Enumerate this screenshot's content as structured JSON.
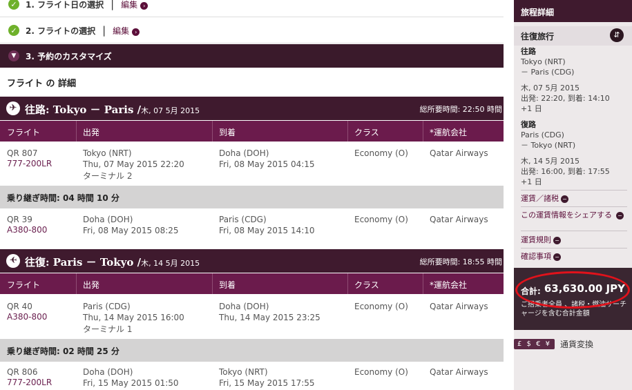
{
  "steps": [
    {
      "label": "1. フライト日の選択",
      "edit": "編集"
    },
    {
      "label": "2. フライトの選択",
      "edit": "編集"
    },
    {
      "label": "3. 予約のカスタマイズ"
    }
  ],
  "section_title": "フライト の 詳細",
  "columns": [
    "フライト",
    "出発",
    "到着",
    "クラス",
    "*運航会社"
  ],
  "outbound": {
    "route": "往路: Tokyo － Paris /",
    "date": "木, 07 5月 2015",
    "duration": "総所要時間: 22:50 時間",
    "seg1": {
      "flight": "QR 807",
      "aircraft": "777-200LR",
      "dep_city": "Tokyo (NRT)",
      "dep_time": "Thu, 07 May 2015 22:20",
      "terminal": "ターミナル 2",
      "arr_city": "Doha (DOH)",
      "arr_time": "Fri, 08 May 2015 04:15",
      "class": "Economy (O)",
      "carrier": "Qatar Airways"
    },
    "connection": "乗り継ぎ時間: 04 時間 10 分",
    "seg2": {
      "flight": "QR 39",
      "aircraft": "A380-800",
      "dep_city": "Doha (DOH)",
      "dep_time": "Fri, 08 May 2015 08:25",
      "arr_city": "Paris (CDG)",
      "arr_time": "Fri, 08 May 2015 14:10",
      "class": "Economy (O)",
      "carrier": "Qatar Airways"
    }
  },
  "inbound": {
    "route": "往復: Paris － Tokyo /",
    "date": "木, 14 5月 2015",
    "duration": "総所要時間: 18:55 時間",
    "seg1": {
      "flight": "QR 40",
      "aircraft": "A380-800",
      "dep_city": "Paris (CDG)",
      "dep_time": "Thu, 14 May 2015 16:00",
      "terminal": "ターミナル 1",
      "arr_city": "Doha (DOH)",
      "arr_time": "Thu, 14 May 2015 23:25",
      "class": "Economy (O)",
      "carrier": "Qatar Airways"
    },
    "connection": "乗り継ぎ時間: 02 時間 25 分",
    "seg2": {
      "flight": "QR 806",
      "aircraft": "777-200LR",
      "dep_city": "Doha (DOH)",
      "dep_time": "Fri, 15 May 2015 01:50",
      "arr_city": "Tokyo (NRT)",
      "arr_time": "Fri, 15 May 2015 17:55",
      "class": "Economy (O)",
      "carrier": "Qatar Airways"
    }
  },
  "sidebar": {
    "title": "旅程詳細",
    "trip_type": "往復旅行",
    "out_label": "往路",
    "out_from": "Tokyo (NRT)",
    "out_to": "－ Paris (CDG)",
    "out_date": "木, 07 5月 2015",
    "out_times": "出発: 22:20, 到着: 14:10",
    "out_plus": "+1 日",
    "ret_label": "復路",
    "ret_from": "Paris (CDG)",
    "ret_to": "－ Tokyo (NRT)",
    "ret_date": "木, 14 5月 2015",
    "ret_times": "出発: 16:00, 到着: 17:55",
    "ret_plus": "+1 日",
    "links": [
      "運賃／諸税",
      "この運賃情報をシェアする",
      "運賃規則",
      "確認事項"
    ],
    "total_label": "合計:",
    "total_amount": "63,630.00 JPY",
    "total_note": "ご搭乗者全員 、諸税・燃油サーチャージを含む合計金額",
    "currency_symbols": "£ $ € ¥",
    "currency_label": "通貨変換"
  },
  "colors": {
    "brand": "#5c0f3a",
    "header_dark": "#3f1a2e",
    "col_header": "#6b1b4c",
    "check": "#6fb12b",
    "highlight_ring": "#e0121b"
  }
}
